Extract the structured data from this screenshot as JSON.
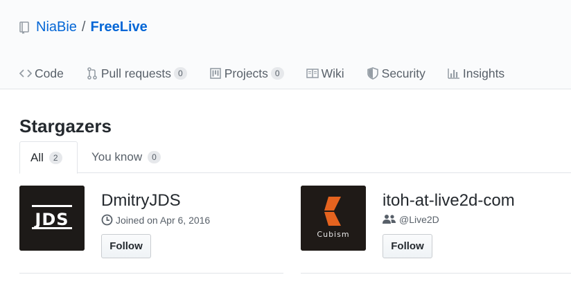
{
  "repo": {
    "owner": "NiaBie",
    "separator": "/",
    "name": "FreeLive"
  },
  "nav": [
    {
      "label": "Code",
      "icon": "code-icon"
    },
    {
      "label": "Pull requests",
      "icon": "pull-request-icon",
      "count": "0"
    },
    {
      "label": "Projects",
      "icon": "project-icon",
      "count": "0"
    },
    {
      "label": "Wiki",
      "icon": "book-icon"
    },
    {
      "label": "Security",
      "icon": "shield-icon"
    },
    {
      "label": "Insights",
      "icon": "graph-icon"
    }
  ],
  "page": {
    "title": "Stargazers"
  },
  "tabs": [
    {
      "label": "All",
      "count": "2",
      "active": true
    },
    {
      "label": "You know",
      "count": "0",
      "active": false
    }
  ],
  "users": [
    {
      "name": "DmitryJDS",
      "meta": "Joined on Apr 6, 2016",
      "meta_icon": "clock-icon",
      "avatar_text": "JDS",
      "follow_label": "Follow"
    },
    {
      "name": "itoh-at-live2d-com",
      "meta": "@Live2D",
      "meta_icon": "organization-icon",
      "avatar_text": "Cubism",
      "follow_label": "Follow"
    }
  ],
  "colors": {
    "link": "#0366d6",
    "text": "#24292e",
    "muted": "#586069",
    "header_bg": "#fafbfc",
    "border": "#e1e4e8",
    "cubism_orange": "#e5631f"
  }
}
